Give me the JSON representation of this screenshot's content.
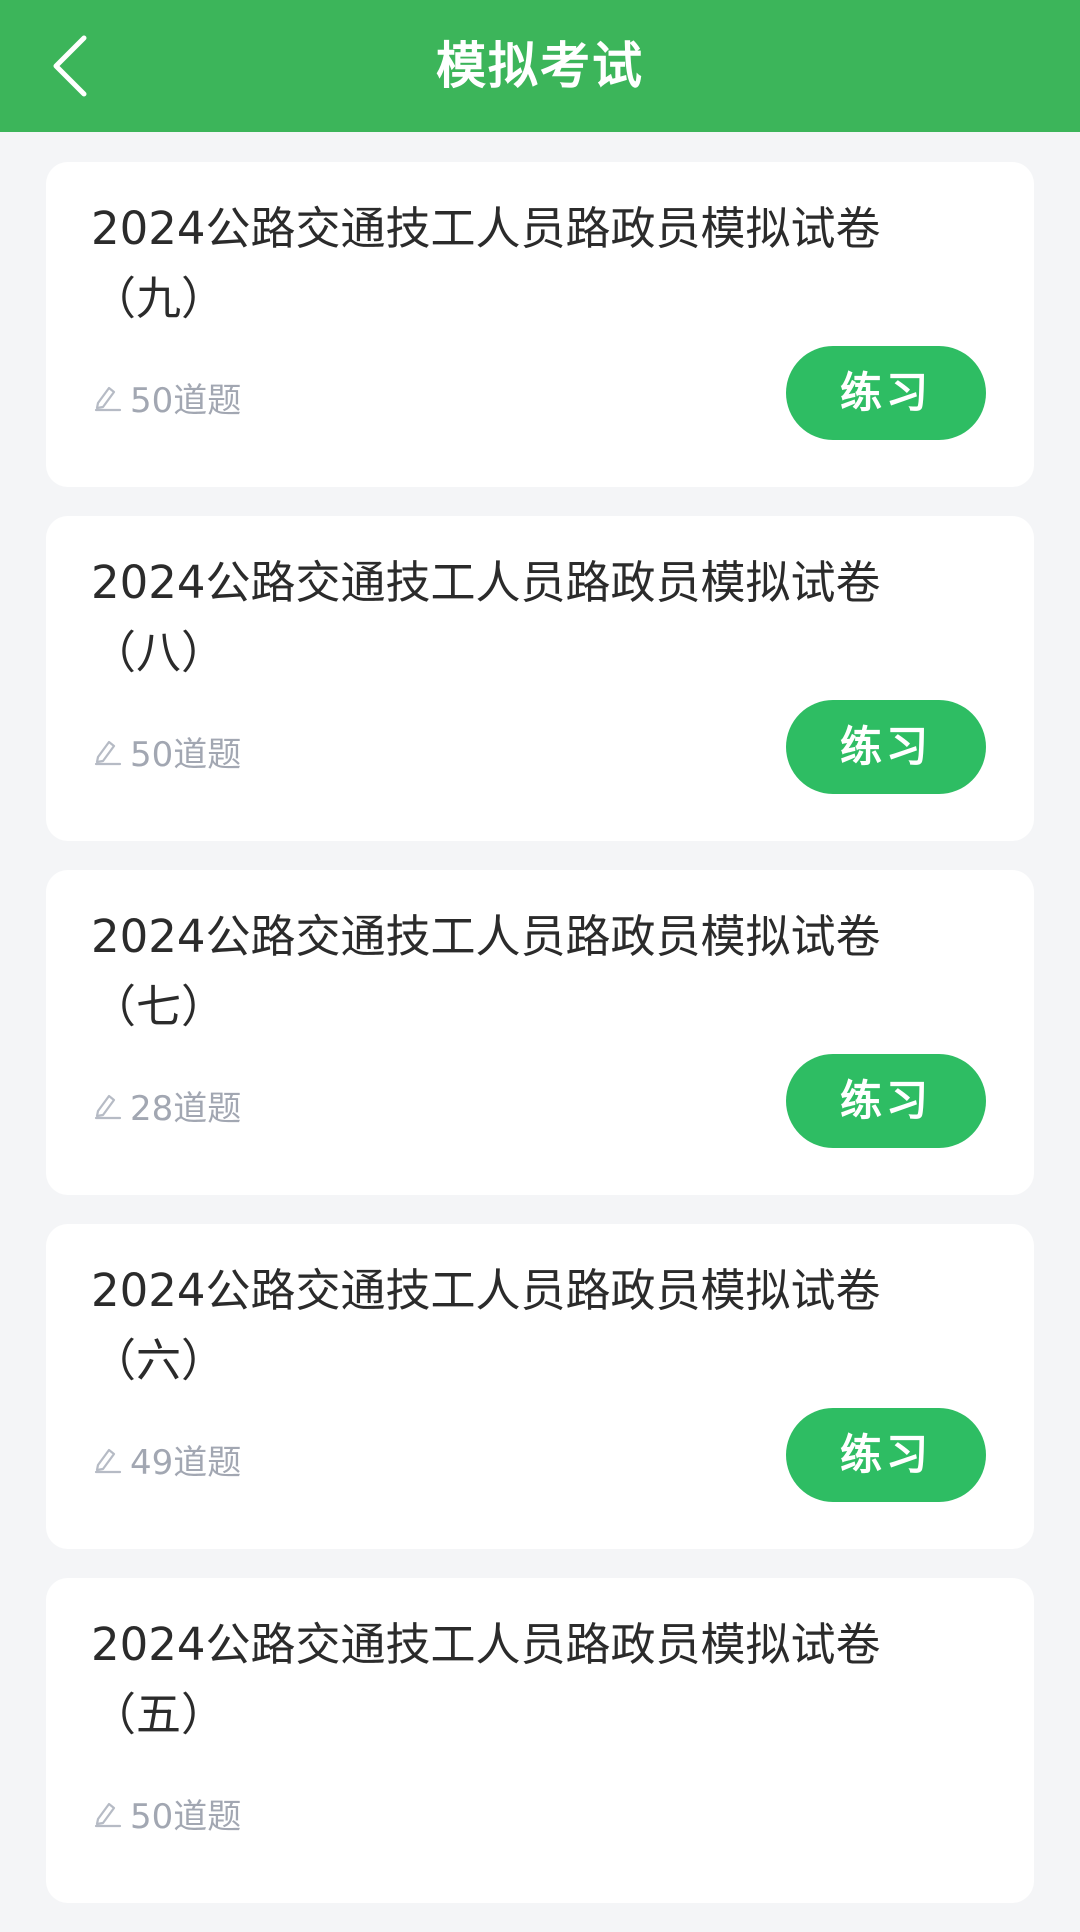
{
  "colors": {
    "brand": "#3cb55a",
    "button": "#2ebd63",
    "background": "#f4f5f7",
    "meta_text": "#a2a7b2"
  },
  "header": {
    "title": "模拟考试",
    "back_icon": "chevron-left-icon"
  },
  "exams": [
    {
      "title": "2024公路交通技工人员路政员模拟试卷（九）",
      "count": "50道题",
      "action": "练习"
    },
    {
      "title": "2024公路交通技工人员路政员模拟试卷（八）",
      "count": "50道题",
      "action": "练习"
    },
    {
      "title": "2024公路交通技工人员路政员模拟试卷（七）",
      "count": "28道题",
      "action": "练习"
    },
    {
      "title": "2024公路交通技工人员路政员模拟试卷（六）",
      "count": "49道题",
      "action": "练习"
    },
    {
      "title": "2024公路交通技工人员路政员模拟试卷（五）",
      "count": "50道题"
    }
  ]
}
